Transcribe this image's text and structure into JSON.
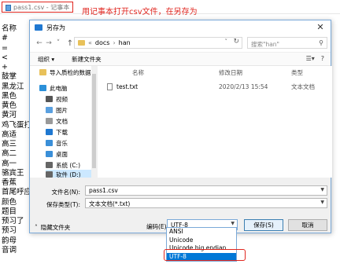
{
  "notepad": {
    "title": "pass1.csv - 记事本",
    "annotation": "用记事本打开csv文件，在另存为",
    "lines": [
      "名称",
      "#",
      "=",
      "<",
      "+",
      "鼓掌",
      "黑龙江",
      "黑色",
      "黄色",
      "黄河",
      "鸡飞蛋打",
      "高适",
      "高三",
      "高二",
      "高一",
      "骆宾王",
      "香蕉",
      "首尾呼应",
      "颜色",
      "题目",
      "预习了",
      "预习",
      "韵母",
      "音调"
    ]
  },
  "dialog": {
    "title": "另存为",
    "close": "✕",
    "nav": {
      "back": "←",
      "forward": "→",
      "dropdown": "˅",
      "up": "↑"
    },
    "breadcrumb": [
      "«",
      "docs",
      "›",
      "han"
    ],
    "search_placeholder": "搜索\"han\"",
    "toolbar": {
      "organize": "组织 ▾",
      "new_folder": "新建文件夹"
    },
    "nav_items": [
      {
        "label": "导入质检的数据",
        "icon": "folder-icon",
        "color": "#e8c15a"
      },
      {
        "label": "此电脑",
        "icon": "computer-icon",
        "color": "#2b90d9"
      },
      {
        "label": "视频",
        "icon": "video-icon",
        "color": "#555555"
      },
      {
        "label": "图片",
        "icon": "pictures-icon",
        "color": "#5aa0e0"
      },
      {
        "label": "文档",
        "icon": "documents-icon",
        "color": "#888888"
      },
      {
        "label": "下载",
        "icon": "download-icon",
        "color": "#1f78d1"
      },
      {
        "label": "音乐",
        "icon": "music-icon",
        "color": "#3a8fd8"
      },
      {
        "label": "桌面",
        "icon": "desktop-icon",
        "color": "#3a8fd8"
      },
      {
        "label": "系统 (C:)",
        "icon": "drive-icon",
        "color": "#666666"
      },
      {
        "label": "软件 (D:)",
        "icon": "drive-icon",
        "color": "#666666"
      }
    ],
    "columns": {
      "name": "名称",
      "date": "修改日期",
      "type": "类型"
    },
    "files": [
      {
        "name": "test.txt",
        "date": "2020/2/13 15:54",
        "type": "文本文档"
      }
    ],
    "filename_label": "文件名(N):",
    "filename_value": "pass1.csv",
    "filetype_label": "保存类型(T):",
    "filetype_value": "文本文档(*.txt)",
    "hide_folders": "隐藏文件夹",
    "encoding_label": "编码(E):",
    "encoding_value": "UTF-8",
    "save_button": "保存(S)",
    "cancel_button": "取消",
    "encoding_options": [
      "ANSI",
      "Unicode",
      "Unicode big endian",
      "UTF-8"
    ]
  }
}
